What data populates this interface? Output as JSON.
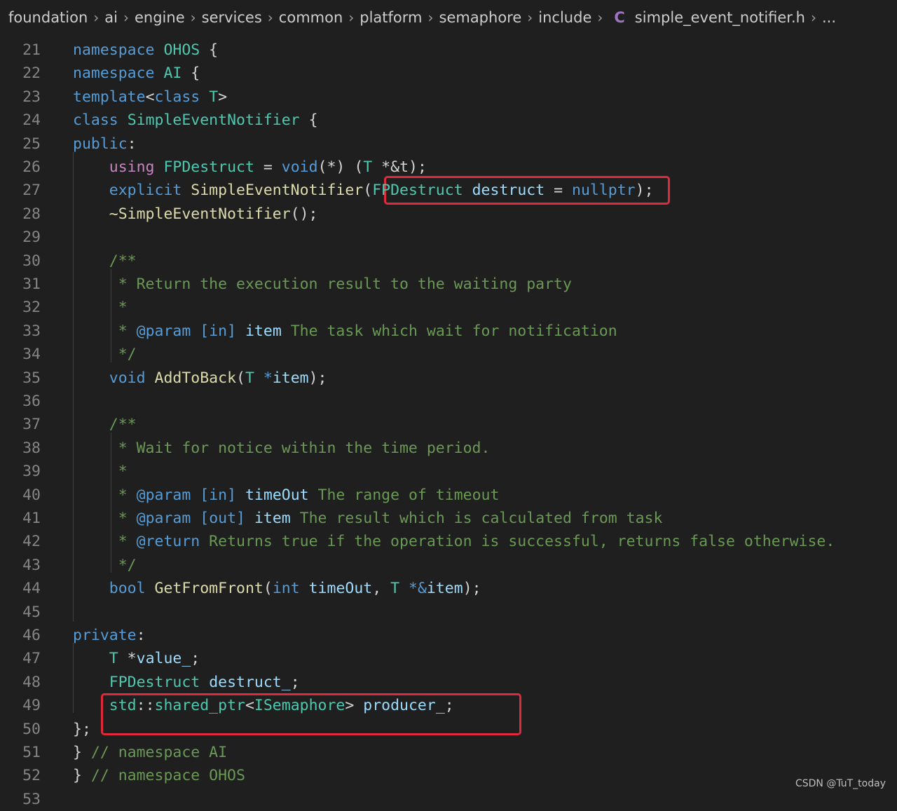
{
  "breadcrumb": {
    "items": [
      "foundation",
      "ai",
      "engine",
      "services",
      "common",
      "platform",
      "semaphore",
      "include"
    ],
    "file_icon": "C",
    "file_name": "simple_event_notifier.h",
    "ellipsis": "..."
  },
  "editor": {
    "lines": [
      {
        "n": "21",
        "tokens": [
          [
            "kw",
            "namespace"
          ],
          [
            "pl",
            " "
          ],
          [
            "ty",
            "OHOS"
          ],
          [
            "pl",
            " {"
          ]
        ]
      },
      {
        "n": "22",
        "tokens": [
          [
            "kw",
            "namespace"
          ],
          [
            "pl",
            " "
          ],
          [
            "ty",
            "AI"
          ],
          [
            "pl",
            " {"
          ]
        ]
      },
      {
        "n": "23",
        "tokens": [
          [
            "kw",
            "template"
          ],
          [
            "pl",
            "<"
          ],
          [
            "kw",
            "class"
          ],
          [
            "pl",
            " "
          ],
          [
            "ty",
            "T"
          ],
          [
            "pl",
            ">"
          ]
        ]
      },
      {
        "n": "24",
        "tokens": [
          [
            "kw",
            "class"
          ],
          [
            "pl",
            " "
          ],
          [
            "ty",
            "SimpleEventNotifier"
          ],
          [
            "pl",
            " {"
          ]
        ]
      },
      {
        "n": "25",
        "tokens": [
          [
            "kw",
            "public"
          ],
          [
            "pl",
            ":"
          ]
        ]
      },
      {
        "n": "26",
        "tokens": [
          [
            "pl",
            "    "
          ],
          [
            "kw2",
            "using"
          ],
          [
            "pl",
            " "
          ],
          [
            "ty",
            "FPDestruct"
          ],
          [
            "pl",
            " = "
          ],
          [
            "kw",
            "void"
          ],
          [
            "pl",
            "(*) ("
          ],
          [
            "ty",
            "T"
          ],
          [
            "pl",
            " *&t);"
          ]
        ]
      },
      {
        "n": "27",
        "tokens": [
          [
            "pl",
            "    "
          ],
          [
            "kw",
            "explicit"
          ],
          [
            "pl",
            " "
          ],
          [
            "fn",
            "SimpleEventNotifier"
          ],
          [
            "pl",
            "("
          ],
          [
            "ty",
            "FPDestruct"
          ],
          [
            "pl",
            " "
          ],
          [
            "var",
            "destruct"
          ],
          [
            "pl",
            " = "
          ],
          [
            "kw",
            "nullptr"
          ],
          [
            "pl",
            ");"
          ]
        ]
      },
      {
        "n": "28",
        "tokens": [
          [
            "pl",
            "    "
          ],
          [
            "fn",
            "~SimpleEventNotifier"
          ],
          [
            "pl",
            "();"
          ]
        ]
      },
      {
        "n": "29",
        "tokens": []
      },
      {
        "n": "30",
        "tokens": [
          [
            "pl",
            "    "
          ],
          [
            "cm",
            "/**"
          ]
        ]
      },
      {
        "n": "31",
        "tokens": [
          [
            "pl",
            "    "
          ],
          [
            "cm",
            " * Return the execution result to the waiting party"
          ]
        ]
      },
      {
        "n": "32",
        "tokens": [
          [
            "pl",
            "    "
          ],
          [
            "cm",
            " *"
          ]
        ]
      },
      {
        "n": "33",
        "tokens": [
          [
            "pl",
            "    "
          ],
          [
            "cm",
            " * "
          ],
          [
            "kw",
            "@param"
          ],
          [
            "pl",
            " "
          ],
          [
            "kw",
            "[in]"
          ],
          [
            "pl",
            " "
          ],
          [
            "var",
            "item"
          ],
          [
            "cm",
            " The task which wait for notification"
          ]
        ]
      },
      {
        "n": "34",
        "tokens": [
          [
            "pl",
            "    "
          ],
          [
            "cm",
            " */"
          ]
        ]
      },
      {
        "n": "35",
        "tokens": [
          [
            "pl",
            "    "
          ],
          [
            "kw",
            "void"
          ],
          [
            "pl",
            " "
          ],
          [
            "fn",
            "AddToBack"
          ],
          [
            "pl",
            "("
          ],
          [
            "ty",
            "T"
          ],
          [
            "pl",
            " "
          ],
          [
            "kw",
            "*"
          ],
          [
            "var",
            "item"
          ],
          [
            "pl",
            ");"
          ]
        ]
      },
      {
        "n": "36",
        "tokens": []
      },
      {
        "n": "37",
        "tokens": [
          [
            "pl",
            "    "
          ],
          [
            "cm",
            "/**"
          ]
        ]
      },
      {
        "n": "38",
        "tokens": [
          [
            "pl",
            "    "
          ],
          [
            "cm",
            " * Wait for notice within the time period."
          ]
        ]
      },
      {
        "n": "39",
        "tokens": [
          [
            "pl",
            "    "
          ],
          [
            "cm",
            " *"
          ]
        ]
      },
      {
        "n": "40",
        "tokens": [
          [
            "pl",
            "    "
          ],
          [
            "cm",
            " * "
          ],
          [
            "kw",
            "@param"
          ],
          [
            "pl",
            " "
          ],
          [
            "kw",
            "[in]"
          ],
          [
            "pl",
            " "
          ],
          [
            "var",
            "timeOut"
          ],
          [
            "cm",
            " The range of timeout"
          ]
        ]
      },
      {
        "n": "41",
        "tokens": [
          [
            "pl",
            "    "
          ],
          [
            "cm",
            " * "
          ],
          [
            "kw",
            "@param"
          ],
          [
            "pl",
            " "
          ],
          [
            "kw",
            "[out]"
          ],
          [
            "pl",
            " "
          ],
          [
            "var",
            "item"
          ],
          [
            "cm",
            " The result which is calculated from task"
          ]
        ]
      },
      {
        "n": "42",
        "tokens": [
          [
            "pl",
            "    "
          ],
          [
            "cm",
            " * "
          ],
          [
            "kw",
            "@return"
          ],
          [
            "cm",
            " Returns true if the operation is successful, returns false otherwise."
          ]
        ]
      },
      {
        "n": "43",
        "tokens": [
          [
            "pl",
            "    "
          ],
          [
            "cm",
            " */"
          ]
        ]
      },
      {
        "n": "44",
        "tokens": [
          [
            "pl",
            "    "
          ],
          [
            "kw",
            "bool"
          ],
          [
            "pl",
            " "
          ],
          [
            "fn",
            "GetFromFront"
          ],
          [
            "pl",
            "("
          ],
          [
            "kw",
            "int"
          ],
          [
            "pl",
            " "
          ],
          [
            "var",
            "timeOut"
          ],
          [
            "pl",
            ", "
          ],
          [
            "ty",
            "T"
          ],
          [
            "pl",
            " "
          ],
          [
            "kw",
            "*&"
          ],
          [
            "var",
            "item"
          ],
          [
            "pl",
            ");"
          ]
        ]
      },
      {
        "n": "45",
        "tokens": []
      },
      {
        "n": "46",
        "tokens": [
          [
            "kw",
            "private"
          ],
          [
            "pl",
            ":"
          ]
        ]
      },
      {
        "n": "47",
        "tokens": [
          [
            "pl",
            "    "
          ],
          [
            "ty",
            "T"
          ],
          [
            "pl",
            " *"
          ],
          [
            "var",
            "value_"
          ],
          [
            "pl",
            ";"
          ]
        ]
      },
      {
        "n": "48",
        "tokens": [
          [
            "pl",
            "    "
          ],
          [
            "ty",
            "FPDestruct"
          ],
          [
            "pl",
            " "
          ],
          [
            "var",
            "destruct_"
          ],
          [
            "pl",
            ";"
          ]
        ]
      },
      {
        "n": "49",
        "tokens": [
          [
            "pl",
            "    "
          ],
          [
            "ty",
            "std"
          ],
          [
            "pl",
            "::"
          ],
          [
            "ty",
            "shared_ptr"
          ],
          [
            "pl",
            "<"
          ],
          [
            "ty",
            "ISemaphore"
          ],
          [
            "pl",
            "> "
          ],
          [
            "var",
            "producer_"
          ],
          [
            "pl",
            ";"
          ]
        ]
      },
      {
        "n": "50",
        "tokens": [
          [
            "pl",
            "};"
          ]
        ]
      },
      {
        "n": "51",
        "tokens": [
          [
            "pl",
            "} "
          ],
          [
            "cm",
            "// namespace AI"
          ]
        ]
      },
      {
        "n": "52",
        "tokens": [
          [
            "pl",
            "} "
          ],
          [
            "cm",
            "// namespace OHOS"
          ]
        ]
      },
      {
        "n": "53",
        "tokens": []
      }
    ]
  },
  "watermark": "CSDN @TuT_today"
}
